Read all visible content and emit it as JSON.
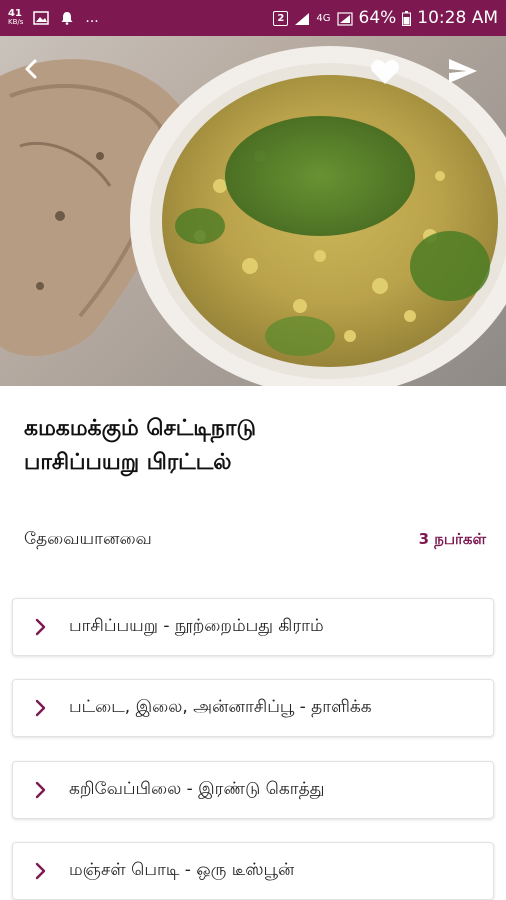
{
  "status": {
    "net_speed": "41",
    "net_unit": "KB/s",
    "dots": "...",
    "sim_badge": "2",
    "network_type": "4G",
    "battery": "64%",
    "time": "10:28 AM"
  },
  "recipe": {
    "title_line1": "கமகமக்கும் செட்டிநாடு",
    "title_line2": "பாசிப்பயறு பிரட்டல்"
  },
  "requirements": {
    "label": "தேவையானவை",
    "servings": "3 நபர்கள்"
  },
  "ingredients": [
    {
      "text": "பாசிப்பயறு - நூற்றைம்பது கிராம்"
    },
    {
      "text": "பட்டை, இலை, அன்னாசிப்பூ - தாளிக்க"
    },
    {
      "text": "கறிவேப்பிலை - இரண்டு கொத்து"
    },
    {
      "text": "மஞ்சள் பொடி - ஒரு டீஸ்பூன்"
    }
  ],
  "icons": {
    "back": "back-arrow-icon",
    "favorite": "heart-icon",
    "share": "send-icon",
    "chevron": "chevron-right-icon"
  },
  "colors": {
    "brand": "#7d1950",
    "text": "#222222"
  }
}
